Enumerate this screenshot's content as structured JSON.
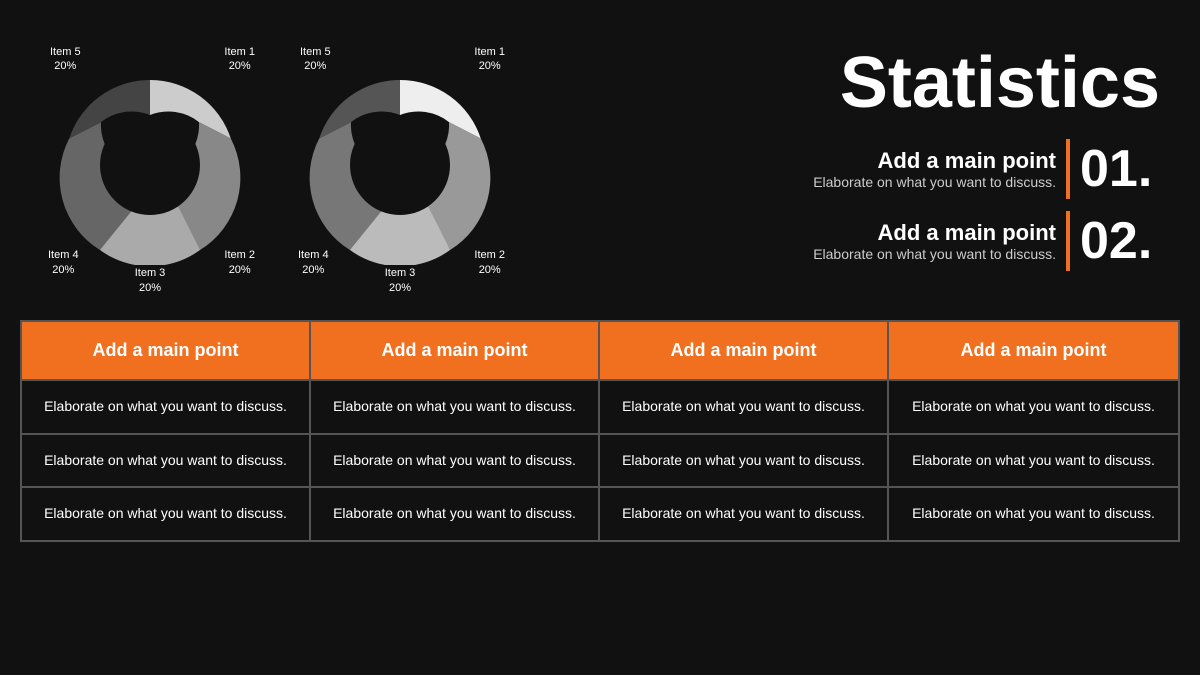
{
  "page": {
    "title": "Statistics",
    "background": "#111111",
    "accent": "#f07020"
  },
  "charts": [
    {
      "id": "chart1",
      "items": [
        {
          "label": "Item 1",
          "pct": "20%",
          "color": "#cccccc",
          "startAngle": -90,
          "endAngle": -18
        },
        {
          "label": "Item 2",
          "pct": "20%",
          "color": "#888888",
          "startAngle": -18,
          "endAngle": 54
        },
        {
          "label": "Item 3",
          "pct": "20%",
          "color": "#aaaaaa",
          "startAngle": 54,
          "endAngle": 126
        },
        {
          "label": "Item 4",
          "pct": "20%",
          "color": "#666666",
          "startAngle": 126,
          "endAngle": 198
        },
        {
          "label": "Item 5",
          "pct": "20%",
          "color": "#444444",
          "startAngle": 198,
          "endAngle": 270
        }
      ]
    },
    {
      "id": "chart2",
      "items": [
        {
          "label": "Item 1",
          "pct": "20%",
          "color": "#dddddd",
          "startAngle": -90,
          "endAngle": -18
        },
        {
          "label": "Item 2",
          "pct": "20%",
          "color": "#999999",
          "startAngle": -18,
          "endAngle": 54
        },
        {
          "label": "Item 3",
          "pct": "20%",
          "color": "#bbbbbb",
          "startAngle": 54,
          "endAngle": 126
        },
        {
          "label": "Item 4",
          "pct": "20%",
          "color": "#777777",
          "startAngle": 126,
          "endAngle": 198
        },
        {
          "label": "Item 5",
          "pct": "20%",
          "color": "#555555",
          "startAngle": 198,
          "endAngle": 270
        }
      ]
    }
  ],
  "stats": {
    "title": "Statistics",
    "points": [
      {
        "main": "Add a main point",
        "elaborate": "Elaborate on what you want to discuss.",
        "number": "01."
      },
      {
        "main": "Add a main point",
        "elaborate": "Elaborate on what you want to discuss.",
        "number": "02."
      }
    ]
  },
  "table": {
    "headers": [
      "Add a main point",
      "Add a main point",
      "Add a main point",
      "Add a main point"
    ],
    "rows": [
      [
        "Elaborate on what you want to discuss.",
        "Elaborate on what you want to discuss.",
        "Elaborate on what you want to discuss.",
        "Elaborate on what you want to discuss."
      ],
      [
        "Elaborate on what you want to discuss.",
        "Elaborate on what you want to discuss.",
        "Elaborate on what you want to discuss.",
        "Elaborate on what you want to discuss."
      ],
      [
        "Elaborate on what you want to discuss.",
        "Elaborate on what you want to discuss.",
        "Elaborate on what you want to discuss.",
        "Elaborate on what you want to discuss."
      ]
    ]
  }
}
